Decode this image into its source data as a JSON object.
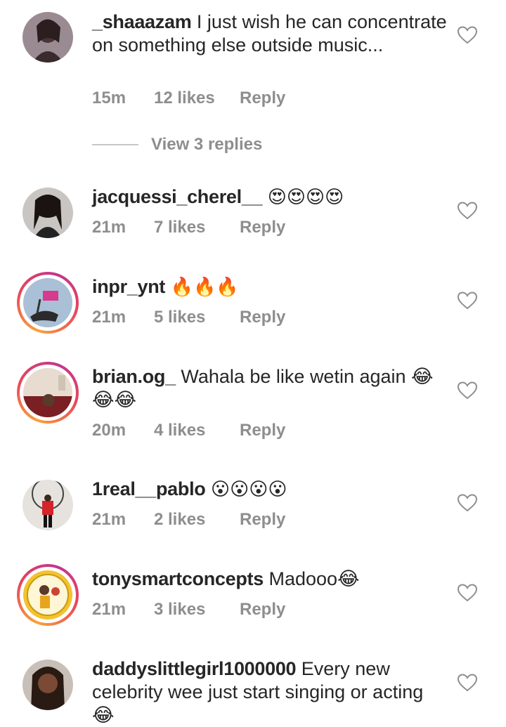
{
  "comments": [
    {
      "username": "_shaaazam",
      "text": "I just wish he can concentrate on something else outside music...",
      "time": "15m",
      "likes": "12 likes",
      "reply": "Reply",
      "view_replies": "View 3 replies"
    },
    {
      "username": "jacquessi_cherel__",
      "text": "😍😍😍😍",
      "time": "21m",
      "likes": "7 likes",
      "reply": "Reply"
    },
    {
      "username": "inpr_ynt",
      "text": "🔥🔥🔥",
      "time": "21m",
      "likes": "5 likes",
      "reply": "Reply"
    },
    {
      "username": "brian.og_",
      "text": "Wahala be like wetin again 😂😂😂",
      "time": "20m",
      "likes": "4 likes",
      "reply": "Reply"
    },
    {
      "username": "1real__pablo",
      "text": "😮😮😮😮",
      "time": "21m",
      "likes": "2 likes",
      "reply": "Reply"
    },
    {
      "username": "tonysmartconcepts",
      "text": "Madooo😂",
      "time": "21m",
      "likes": "3 likes",
      "reply": "Reply"
    },
    {
      "username": "daddyslittlegirl1000000",
      "text": "Every new celebrity wee just start singing or acting 😂",
      "time": "",
      "likes": "",
      "reply": ""
    }
  ],
  "icons": {
    "like": "heart-outline-icon"
  },
  "colors": {
    "text": "#262626",
    "meta": "#8e8e8e",
    "story_ring": "#e8475b"
  }
}
